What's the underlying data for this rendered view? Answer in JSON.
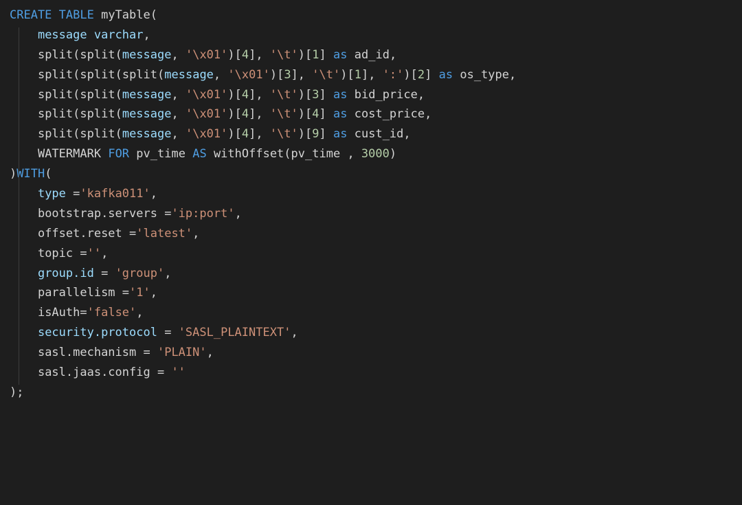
{
  "kw": {
    "create_table": "CREATE TABLE",
    "as": "as",
    "as_caps": "AS",
    "with": "WITH",
    "for": "FOR",
    "watermark": "WATERMARK"
  },
  "ident": {
    "table_name": "myTable",
    "message": "message",
    "varchar": "varchar",
    "split": "split",
    "ad_id": "ad_id",
    "os_type": "os_type",
    "bid_price": "bid_price",
    "cost_price": "cost_price",
    "cust_id": "cust_id",
    "pv_time": "pv_time",
    "withOffset": "withOffset",
    "type": "type",
    "bootstrap_servers": "bootstrap.servers",
    "offset_reset": "offset.reset",
    "topic": "topic",
    "group_id": "group.id",
    "parallelism": "parallelism",
    "isAuth": "isAuth",
    "security_protocol": "security.protocol",
    "sasl_mechanism": "sasl.mechanism",
    "sasl_jaas_config": "sasl.jaas.config"
  },
  "str": {
    "x01": "'\\x01'",
    "tab": "'\\t'",
    "colon": "':'",
    "kafka011": "'kafka011'",
    "ip_port": "'ip:port'",
    "latest": "'latest'",
    "empty": "''",
    "group": "'group'",
    "one": "'1'",
    "false": "'false'",
    "sasl_plaintext": "'SASL_PLAINTEXT'",
    "plain": "'PLAIN'"
  },
  "num": {
    "n1": "1",
    "n2": "2",
    "n3": "3",
    "n4": "4",
    "n9": "9",
    "n3000": "3000"
  },
  "punct": {
    "open_paren": "(",
    "close_paren": ")",
    "comma": ",",
    "semicolon": ";",
    "eq": "=",
    "lbr": "[",
    "rbr": "]",
    "space": " "
  }
}
